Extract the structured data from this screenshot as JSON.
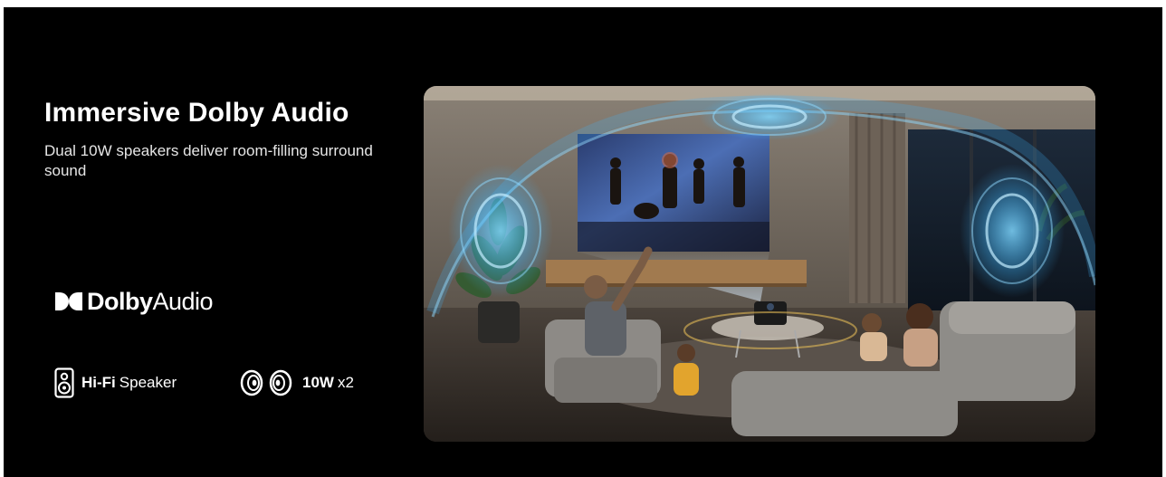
{
  "headline": "Immersive Dolby Audio",
  "subheadline": "Dual 10W speakers deliver room-filling surround sound",
  "dolby_logo": {
    "brand": "Dolby",
    "product": "Audio",
    "icon": "dolby-double-d-icon"
  },
  "specs": [
    {
      "icon": "speaker-icon",
      "strong": "Hi-Fi",
      "rest": "Speaker"
    },
    {
      "icon": "dual-speaker-icon",
      "strong": "10W",
      "rest": "x2"
    }
  ],
  "colors": {
    "background": "#000000",
    "text": "#ffffff",
    "sound_wave": "#3fb7ff",
    "projector_beam": "#cfe6ff"
  }
}
